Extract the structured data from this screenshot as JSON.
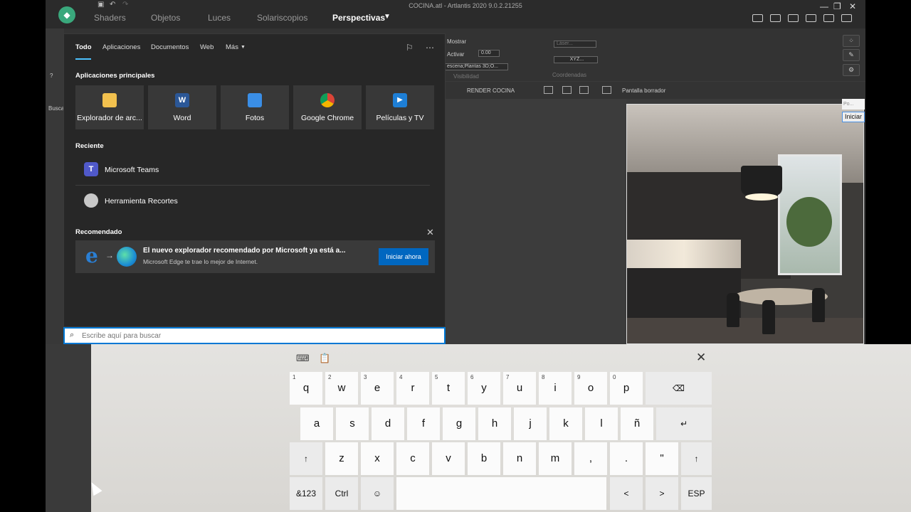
{
  "app": {
    "window_title": "COCINA.atl - Artlantis 2020 9.0.2.21255",
    "menus": [
      "Shaders",
      "Objetos",
      "Luces",
      "Solariscopios",
      "Perspectivas"
    ],
    "active_menu": "Perspectivas",
    "toolbar": {
      "mostrar": "Mostrar",
      "activar": "Activar",
      "activar_value": "0.00",
      "scene_select": "escena;Plantas 3D;O...",
      "visibilidad": "Visibilidad",
      "layer_box": "Láser...",
      "xyz_button": "XYZ...",
      "coordenadas": "Coordenadas"
    },
    "viewbar": {
      "render_label": "RENDER COCINA",
      "screen_label": "Pantalla borrador"
    },
    "left_panel": {
      "help": "?",
      "search": "Buscar"
    },
    "side": {
      "pos_label": "Po...",
      "iniciar": "Iniciar"
    }
  },
  "start_menu": {
    "tabs": [
      "Todo",
      "Aplicaciones",
      "Documentos",
      "Web",
      "Más"
    ],
    "active_tab": "Todo",
    "pinned_title": "Aplicaciones principales",
    "pinned": [
      {
        "label": "Explorador de arc...",
        "icon": "folder-icon",
        "color": "#f2c14e"
      },
      {
        "label": "Word",
        "icon": "word-icon",
        "color": "#2b5797"
      },
      {
        "label": "Fotos",
        "icon": "photos-icon",
        "color": "#3a8ee6"
      },
      {
        "label": "Google Chrome",
        "icon": "chrome-icon",
        "color": "#db4437"
      },
      {
        "label": "Películas y TV",
        "icon": "movies-icon",
        "color": "#1e7fd6"
      }
    ],
    "recent_title": "Reciente",
    "recent": [
      {
        "label": "Microsoft Teams",
        "icon": "teams-icon",
        "color": "#5059c9"
      },
      {
        "label": "Herramienta Recortes",
        "icon": "snipping-tool-icon",
        "color": "#c8c8c8"
      }
    ],
    "recommended_title": "Recomendado",
    "recommended": {
      "title": "El nuevo explorador recomendado por Microsoft ya está a...",
      "subtitle": "Microsoft Edge te trae lo mejor de Internet.",
      "button": "Iniciar ahora"
    },
    "search_placeholder": "Escribe aquí para buscar"
  },
  "keyboard": {
    "row1": [
      {
        "key": "q",
        "num": "1"
      },
      {
        "key": "w",
        "num": "2"
      },
      {
        "key": "e",
        "num": "3"
      },
      {
        "key": "r",
        "num": "4"
      },
      {
        "key": "t",
        "num": "5"
      },
      {
        "key": "y",
        "num": "6"
      },
      {
        "key": "u",
        "num": "7"
      },
      {
        "key": "i",
        "num": "8"
      },
      {
        "key": "o",
        "num": "9"
      },
      {
        "key": "p",
        "num": "0"
      }
    ],
    "backspace": "⌫",
    "row2": [
      "a",
      "s",
      "d",
      "f",
      "g",
      "h",
      "j",
      "k",
      "l",
      "ñ"
    ],
    "enter": "↵",
    "shift": "↑",
    "row3": [
      "z",
      "x",
      "c",
      "v",
      "b",
      "n",
      "m",
      ",",
      ".",
      "\""
    ],
    "numsym": "&123",
    "ctrl": "Ctrl",
    "emoji": "☺",
    "left": "<",
    "right": ">",
    "lang": "ESP"
  }
}
